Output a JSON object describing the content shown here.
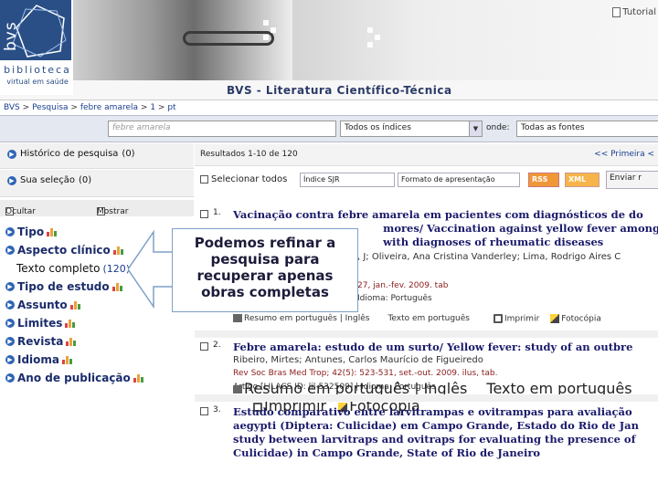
{
  "header": {
    "logo": {
      "mark": "bvs",
      "line1": "biblioteca",
      "line2": "virtual em saúde"
    },
    "site_title": "BVS - Literatura Científico-Técnica",
    "tutorial_label": "Tutorial"
  },
  "breadcrumb": {
    "items": [
      "BVS",
      "Pesquisa",
      "febre amarela",
      "1",
      "pt"
    ],
    "separator": ">"
  },
  "search": {
    "query_placeholder": "febre amarela",
    "index_select": "Todos os índices",
    "where_label": "onde:",
    "source_select": "Todas as fontes"
  },
  "sidebar": {
    "history_label": "Histórico de pesquisa",
    "history_count": "(0)",
    "selection_label": "Sua seleção",
    "selection_count": "(0)",
    "hide_label": "Ocultar",
    "show_label": "Mostrar",
    "facets": [
      {
        "label": "Tipo",
        "count": ""
      },
      {
        "label": "Aspecto clínico",
        "count": ""
      },
      {
        "label": "Texto completo",
        "count": "(120)"
      },
      {
        "label": "Tipo de estudo",
        "count": ""
      },
      {
        "label": "Assunto",
        "count": ""
      },
      {
        "label": "Limites",
        "count": ""
      },
      {
        "label": "Revista",
        "count": ""
      },
      {
        "label": "Idioma",
        "count": ""
      },
      {
        "label": "Ano de publicação",
        "count": ""
      }
    ]
  },
  "results": {
    "summary": "Resultados 1-10 de 120",
    "first_page": "<< Primeira <",
    "select_all": "Selecionar todos",
    "index_select": "Índice SJR",
    "format_select": "Formato de apresentação",
    "rss": "RSS",
    "xml": "XML",
    "send": "Enviar r"
  },
  "records": [
    {
      "num": "1.",
      "title_lines": [
        "Vacinação contra febre amarela em pacientes com diagnósticos de do",
        "                                         mores/ Vaccination against yellow fever among p",
        "                                         with diagnoses of rheumatic diseases"
      ],
      "authors": ", J; Oliveira, Ana Cristina Vanderley; Lima, Rodrigo Aires C",
      "source": "27, jan.-fev. 2009. tab",
      "meta": "Idioma: Português",
      "links": [
        "Resumo em português | Inglês",
        "Texto em português",
        "Imprimir",
        "Fotocópia"
      ]
    },
    {
      "num": "2.",
      "title_lines": [
        "Febre amarela: estudo de um surto/ Yellow fever: study of an outbre"
      ],
      "authors": "Ribeiro, Mirtes; Antunes, Carlos Maurício de Figueiredo",
      "source": "Rev Soc Bras Med Trop; 42(5): 523-531, set.-out. 2009. ilus, tab.",
      "meta": "Artigo [LILACS ID: lil-532509] | Idioma: Português",
      "links": [
        "Resumo em português | Inglês",
        "Texto em português",
        "Imprimir",
        "Fotocópia"
      ]
    },
    {
      "num": "3.",
      "title_lines": [
        "Estudo comparativo entre larvitrampas e ovitrampas para avaliação",
        "aegypti (Diptera: Culicidae) em Campo Grande, Estado do Rio de Jan",
        "study between larvitraps and ovitraps for evaluating the presence of",
        "Culicidae) in Campo Grande, State of Rio de Janeiro"
      ]
    }
  ],
  "callout": {
    "lines": [
      "Podemos refinar a",
      "pesquisa para",
      "recuperar apenas",
      "obras completas"
    ]
  },
  "colors": {
    "brand": "#2a4f86",
    "title": "#1a1a6b",
    "link": "#1a3f8f"
  }
}
